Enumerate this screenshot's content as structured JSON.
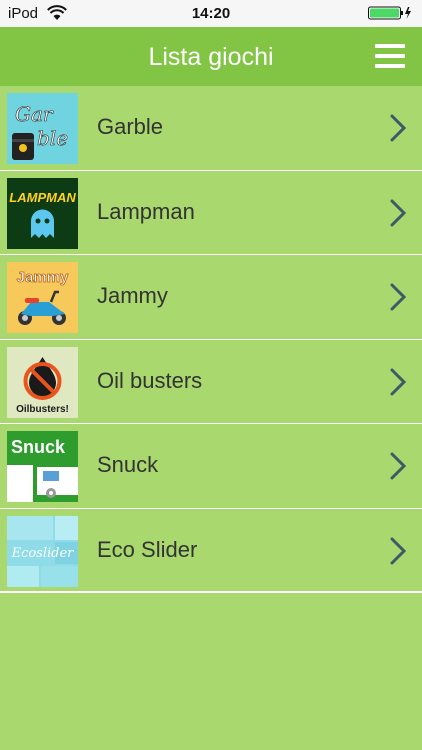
{
  "status_bar": {
    "carrier": "iPod",
    "time": "14:20"
  },
  "header": {
    "title": "Lista giochi",
    "menu_icon": "hamburger-menu-icon"
  },
  "games": [
    {
      "label": "Garble",
      "thumb_text": "Gar ble",
      "thumb_bg": "#6fd3e0"
    },
    {
      "label": "Lampman",
      "thumb_text": "LAMPMAN",
      "thumb_bg": "#0d3b14"
    },
    {
      "label": "Jammy",
      "thumb_text": "Jammy",
      "thumb_bg": "#f7c85a"
    },
    {
      "label": "Oil busters",
      "thumb_text": "Oilbusters!",
      "thumb_bg": "#dfe8c0"
    },
    {
      "label": "Snuck",
      "thumb_text": "Snuck",
      "thumb_bg": "#2e9d2e"
    },
    {
      "label": "Eco Slider",
      "thumb_text": "Ecoslider",
      "thumb_bg": "#8fdce8"
    }
  ],
  "colors": {
    "background": "#a9d86e",
    "nav_bar": "#82c545",
    "chevron": "#3d5a66"
  }
}
